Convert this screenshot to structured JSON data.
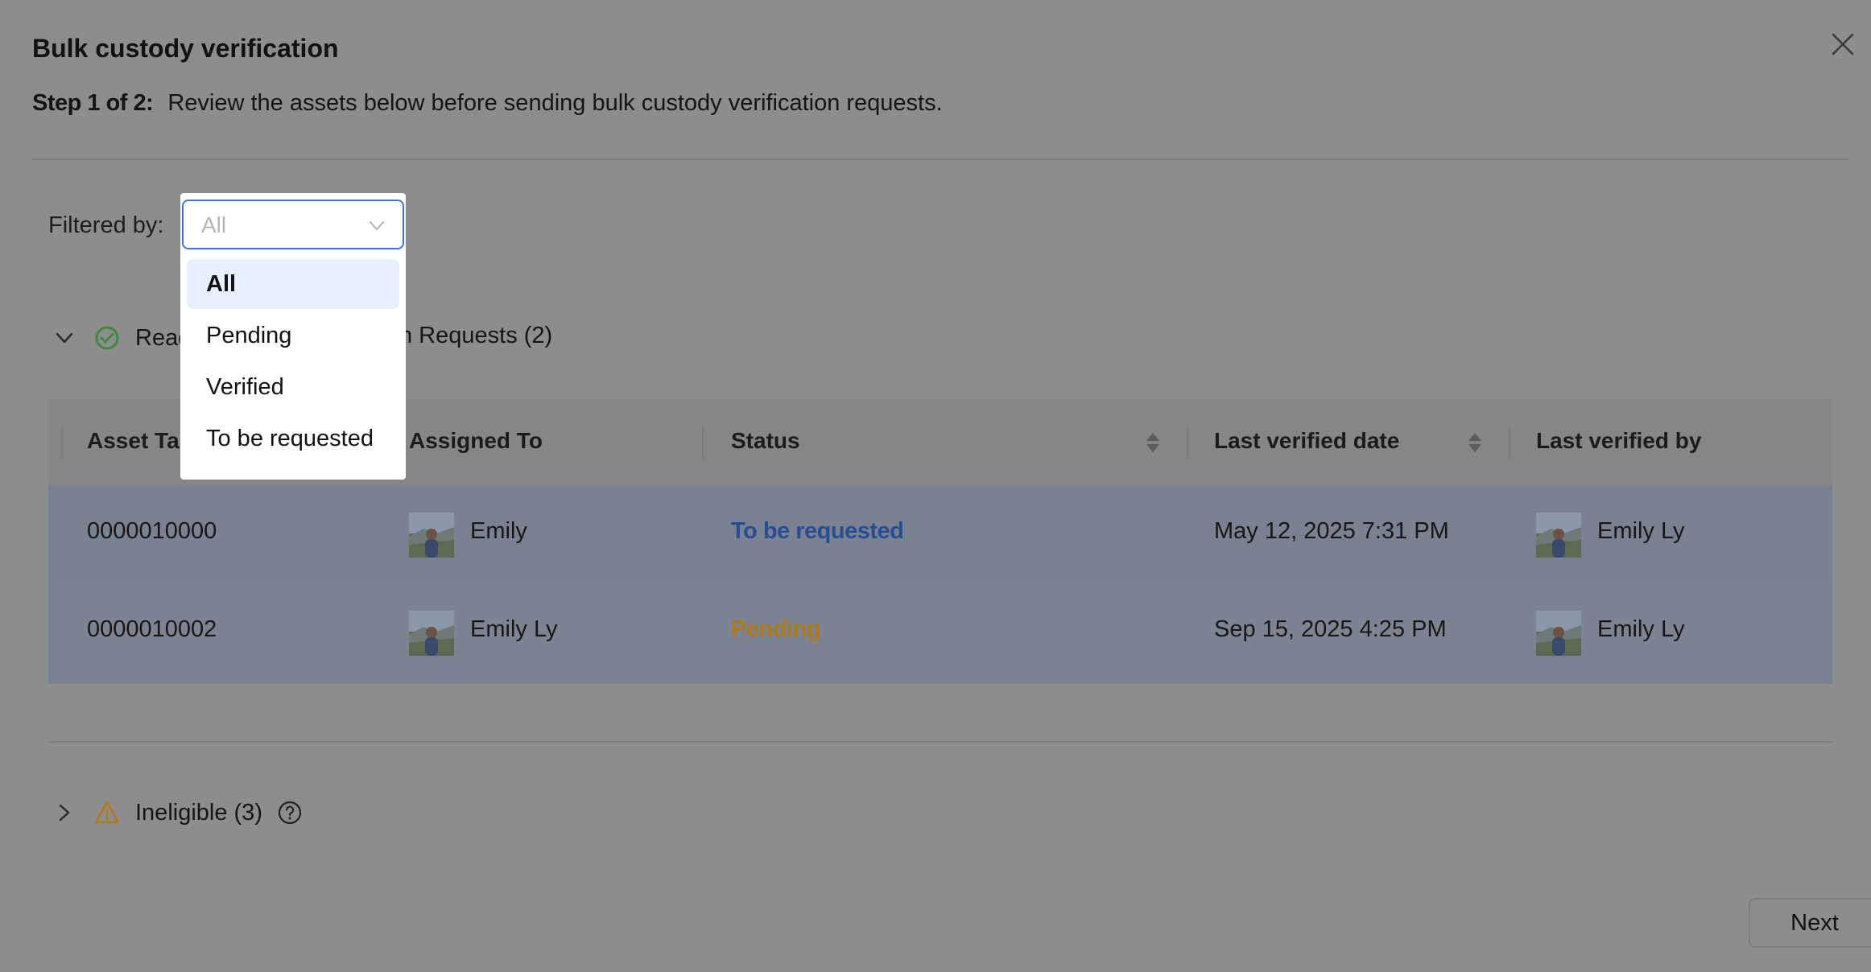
{
  "dialog": {
    "title": "Bulk custody verification",
    "step_label": "Step 1 of 2:",
    "step_text": "Review the assets below before sending bulk custody verification requests."
  },
  "filter": {
    "label": "Filtered by:",
    "value": "All",
    "options": [
      "All",
      "Pending",
      "Verified",
      "To be requested"
    ]
  },
  "ready_group": {
    "label_visible_start": "Read",
    "label_visible_end": "n Requests (2)"
  },
  "table": {
    "columns": [
      "Asset Ta",
      "Assigned To",
      "Status",
      "Last verified date",
      "Last verified by"
    ],
    "rows": [
      {
        "asset_tag": "0000010000",
        "assigned_to": "Emily",
        "status": "To be requested",
        "last_verified_date": "May 12, 2025 7:31 PM",
        "last_verified_by": "Emily Ly"
      },
      {
        "asset_tag": "0000010002",
        "assigned_to": "Emily Ly",
        "status": "Pending",
        "last_verified_date": "Sep 15, 2025 4:25 PM",
        "last_verified_by": "Emily Ly"
      }
    ]
  },
  "ineligible": {
    "label": "Ineligible (3)"
  },
  "footer": {
    "next_label": "Next"
  },
  "colors": {
    "overlay": "#8d8d8d",
    "focus_border": "#3f73d6",
    "status_to_be_requested": "#274d93",
    "status_pending": "#ad7a1e",
    "success_icon": "#3f8a3a",
    "warning_icon": "#b07a1c"
  },
  "icons": [
    "close-icon",
    "chevron-down-icon",
    "check-circle-icon",
    "sort-icon",
    "chevron-right-icon",
    "warning-icon",
    "help-circle-icon",
    "avatar"
  ]
}
